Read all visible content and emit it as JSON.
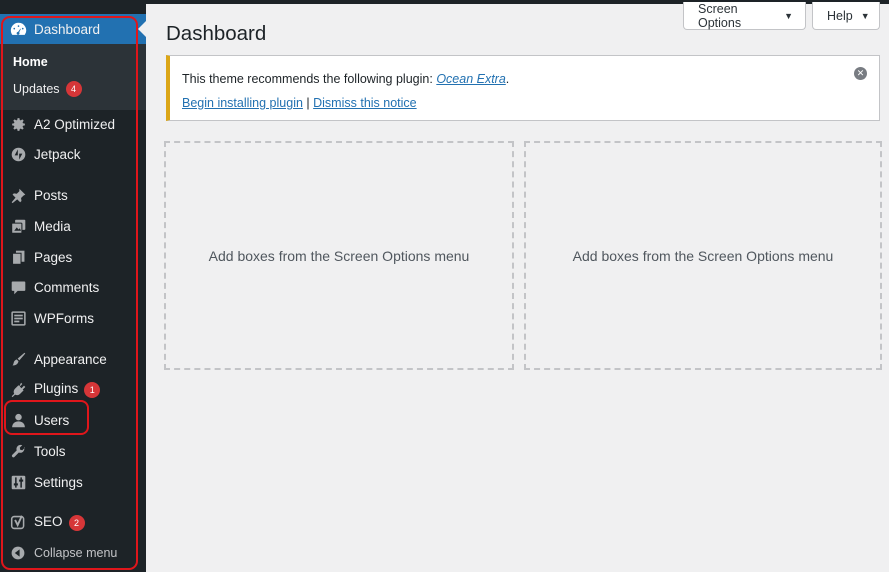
{
  "sidebar": {
    "dashboard": "Dashboard",
    "submenu": {
      "home": "Home",
      "updates": "Updates",
      "updates_count": "4"
    },
    "items": [
      {
        "label": "A2 Optimized",
        "icon": "gear-icon"
      },
      {
        "label": "Jetpack",
        "icon": "jetpack-icon"
      },
      {
        "label": "Posts",
        "icon": "pin-icon"
      },
      {
        "label": "Media",
        "icon": "media-icon"
      },
      {
        "label": "Pages",
        "icon": "pages-icon"
      },
      {
        "label": "Comments",
        "icon": "comment-icon"
      },
      {
        "label": "WPForms",
        "icon": "form-icon"
      },
      {
        "label": "Appearance",
        "icon": "brush-icon"
      },
      {
        "label": "Plugins",
        "icon": "plug-icon",
        "badge": "1"
      },
      {
        "label": "Users",
        "icon": "user-icon"
      },
      {
        "label": "Tools",
        "icon": "wrench-icon"
      },
      {
        "label": "Settings",
        "icon": "settings-icon"
      },
      {
        "label": "SEO",
        "icon": "yoast-icon",
        "badge": "2"
      }
    ],
    "collapse": "Collapse menu"
  },
  "header": {
    "screen_options": "Screen Options",
    "help": "Help",
    "title": "Dashboard"
  },
  "notice": {
    "text": "This theme recommends the following plugin:",
    "plugin_link": "Ocean Extra",
    "period": ".",
    "install_link": "Begin installing plugin",
    "separator": " | ",
    "dismiss_link": "Dismiss this notice"
  },
  "boxes": {
    "left": "Add boxes from the Screen Options menu",
    "right": "Add boxes from the Screen Options menu"
  },
  "colors": {
    "sidebar_bg": "#1d2327",
    "active_blue": "#2271b1",
    "badge_red": "#d63638",
    "notice_border": "#dba617",
    "highlight_red": "#e0161b"
  }
}
